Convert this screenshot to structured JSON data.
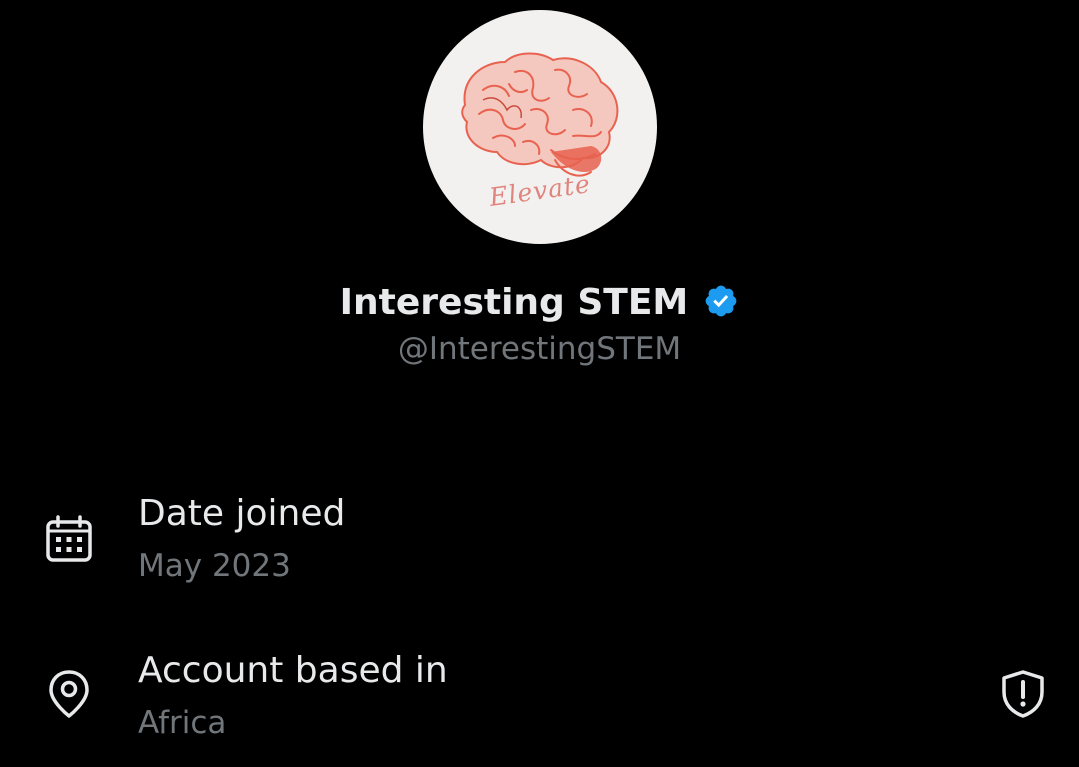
{
  "profile": {
    "display_name": "Interesting STEM",
    "handle": "@InterestingSTEM",
    "avatar_wordmark": "Elevate",
    "verified": true
  },
  "about": {
    "rows": [
      {
        "icon": "calendar-icon",
        "label": "Date joined",
        "value": "May 2023"
      },
      {
        "icon": "location-pin-icon",
        "label": "Account based in",
        "value": "Africa",
        "trailing_icon": "shield-alert-icon"
      }
    ]
  },
  "colors": {
    "background": "#000000",
    "primary_text": "#e7e9ea",
    "secondary_text": "#71767b",
    "verified_badge": "#1d9bf0",
    "avatar_background": "#f2f1ef",
    "avatar_illustration": "#e8624f"
  }
}
